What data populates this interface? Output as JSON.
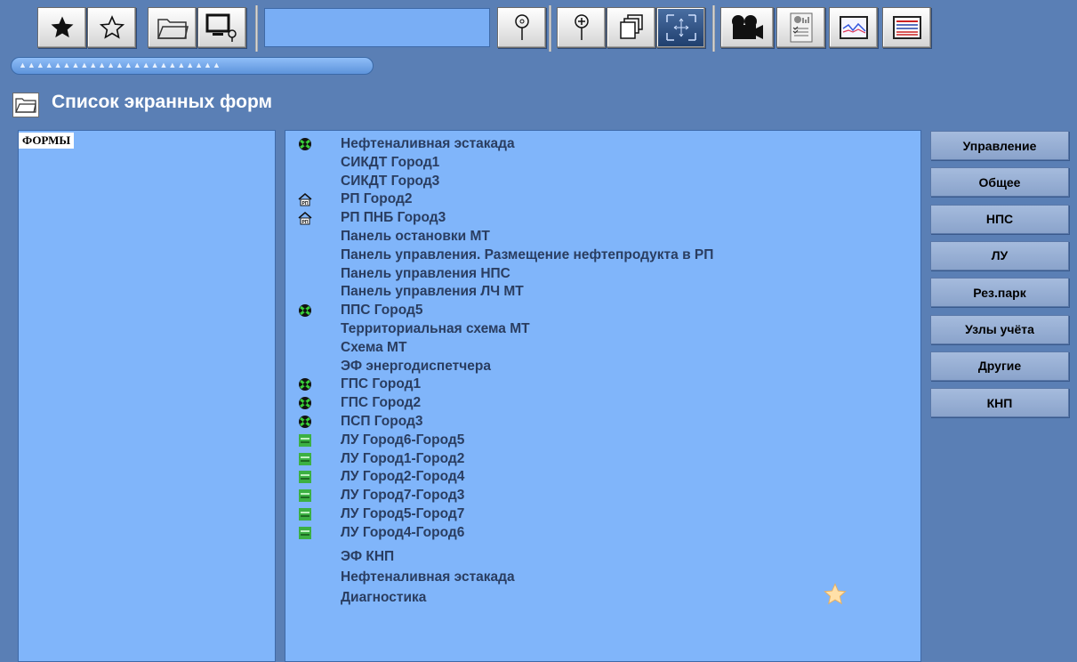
{
  "toolbar": {
    "search_value": "",
    "buttons": [
      {
        "name": "favorite-add-button",
        "icon": "star-filled-icon"
      },
      {
        "name": "favorite-list-button",
        "icon": "star-outline-icon"
      },
      {
        "name": "open-folder-button",
        "icon": "folder-icon"
      },
      {
        "name": "find-screen-button",
        "icon": "monitor-search-icon"
      },
      {
        "name": "search-button",
        "icon": "magnifier-icon"
      },
      {
        "name": "zoom-in-button",
        "icon": "zoom-in-icon"
      },
      {
        "name": "windows-button",
        "icon": "stacked-windows-icon"
      },
      {
        "name": "fit-screen-button",
        "icon": "expand-arrows-icon"
      },
      {
        "name": "camera-button",
        "icon": "video-camera-icon"
      },
      {
        "name": "report-button",
        "icon": "report-chart-icon"
      },
      {
        "name": "trend-button",
        "icon": "trend-chart-icon"
      },
      {
        "name": "table-button",
        "icon": "table-icon"
      }
    ],
    "slider_ticks": "▲▲▲▲▲▲▲▲▲▲▲▲▲▲▲▲▲▲▲▲▲▲▲"
  },
  "page_title": "Список экранных форм",
  "left_panel": {
    "label": "ФОРМЫ"
  },
  "colors": {
    "background": "#5a7fb5",
    "panel": "#80b5fa",
    "text": "#2a3d60"
  },
  "forms": [
    {
      "label": "Нефтеналивная эстакада",
      "icon": "station-green-icon"
    },
    {
      "label": "СИКДТ Город1",
      "icon": ""
    },
    {
      "label": "СИКДТ Город3",
      "icon": ""
    },
    {
      "label": "РП Город2",
      "icon": "rp-house-icon"
    },
    {
      "label": "РП ПНБ Город3",
      "icon": "rp-house-icon"
    },
    {
      "label": "Панель остановки МТ",
      "icon": ""
    },
    {
      "label": "Панель управления. Размещение нефтепродукта в РП",
      "icon": ""
    },
    {
      "label": "Панель управления НПС",
      "icon": ""
    },
    {
      "label": "Панель управления ЛЧ МТ",
      "icon": ""
    },
    {
      "label": "ППС Город5",
      "icon": "station-green-icon"
    },
    {
      "label": "Территориальная схема МТ",
      "icon": ""
    },
    {
      "label": "Схема МТ",
      "icon": ""
    },
    {
      "label": "ЭФ энергодиспетчера",
      "icon": ""
    },
    {
      "label": "ГПС Город1",
      "icon": "station-green-icon"
    },
    {
      "label": "ГПС Город2",
      "icon": "station-green-icon"
    },
    {
      "label": "ПСП Город3",
      "icon": "station-green-icon"
    },
    {
      "label": "ЛУ Город6-Город5",
      "icon": "valve-green-icon"
    },
    {
      "label": "ЛУ Город1-Город2",
      "icon": "valve-green-icon"
    },
    {
      "label": "ЛУ Город2-Город4",
      "icon": "valve-green-icon"
    },
    {
      "label": "ЛУ Город7-Город3",
      "icon": "valve-green-icon"
    },
    {
      "label": "ЛУ Город5-Город7",
      "icon": "valve-green-icon"
    },
    {
      "label": "ЛУ Город4-Город6",
      "icon": "valve-green-icon"
    },
    {
      "label": "ЭФ КНП",
      "icon": ""
    },
    {
      "label": "Нефтеналивная эстакада",
      "icon": ""
    },
    {
      "label": "Диагностика",
      "icon": ""
    }
  ],
  "categories": [
    {
      "label": "Управление"
    },
    {
      "label": "Общее"
    },
    {
      "label": "НПС"
    },
    {
      "label": "ЛУ"
    },
    {
      "label": "Рез.парк"
    },
    {
      "label": "Узлы учёта"
    },
    {
      "label": "Другие"
    },
    {
      "label": "КНП"
    }
  ]
}
